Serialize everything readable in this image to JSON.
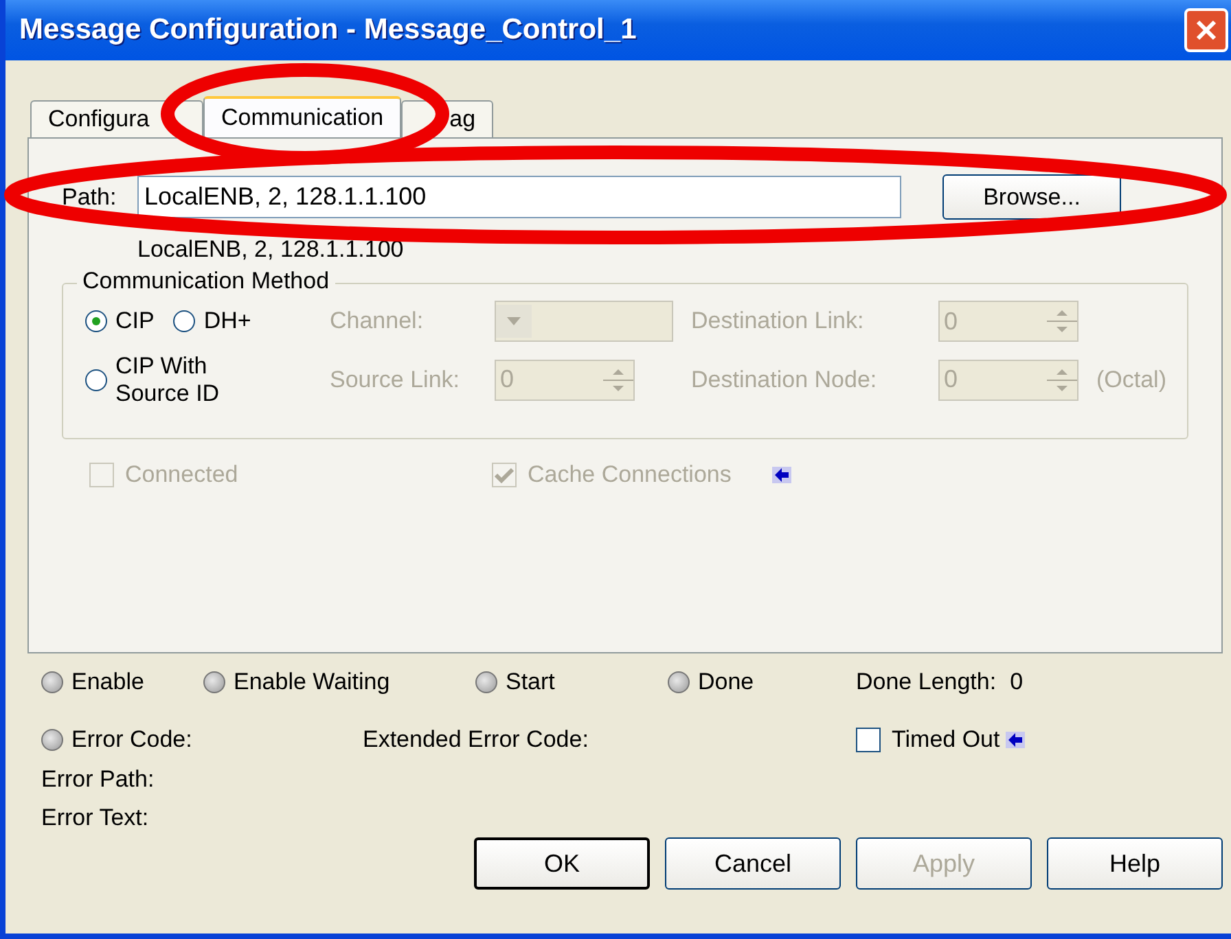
{
  "window": {
    "title": "Message Configuration - Message_Control_1"
  },
  "tabs": [
    {
      "label": "Configura",
      "selected": false
    },
    {
      "label": "Communication",
      "selected": true
    },
    {
      "label": "ag",
      "selected": false
    }
  ],
  "path": {
    "label": "Path:",
    "value": "LocalENB, 2, 128.1.1.100",
    "resolved": "LocalENB, 2, 128.1.1.100"
  },
  "browse_button": {
    "label": "Browse..."
  },
  "communication_method": {
    "title": "Communication Method",
    "radios": [
      {
        "label": "CIP",
        "selected": true
      },
      {
        "label": "DH+",
        "selected": false
      },
      {
        "label": "CIP With Source ID",
        "selected": false
      }
    ],
    "fields": [
      {
        "kind": "dropdown",
        "label": "Channel:",
        "disabled": true
      },
      {
        "kind": "spinner",
        "label": "Destination Link:",
        "value": "0",
        "disabled": true
      },
      {
        "kind": "spinner",
        "label": "Source Link:",
        "value": "0",
        "disabled": true
      },
      {
        "kind": "spinner",
        "label": "Destination Node:",
        "value": "0",
        "disabled": true,
        "suffix": "(Octal)"
      }
    ]
  },
  "options": [
    {
      "label": "Connected",
      "checked": false,
      "disabled": true
    },
    {
      "label": "Cache Connections",
      "checked": true,
      "disabled": true,
      "pointer": true
    }
  ],
  "status": {
    "lamps": [
      {
        "label": "Enable",
        "on": false
      },
      {
        "label": "Enable Waiting",
        "on": false
      },
      {
        "label": "Start",
        "on": false
      },
      {
        "label": "Done",
        "on": false
      }
    ],
    "done_length": {
      "label": "Done Length:",
      "value": "0"
    },
    "error_code": {
      "label": "Error Code:",
      "on": false
    },
    "extended_error_code": "Extended Error Code:",
    "timed_out": {
      "label": "Timed Out",
      "checked": false,
      "pointer": true
    },
    "error_path": "Error Path:",
    "error_text": "Error Text:"
  },
  "buttons": [
    {
      "label": "OK",
      "disabled": false,
      "default": true
    },
    {
      "label": "Cancel",
      "disabled": false,
      "default": false
    },
    {
      "label": "Apply",
      "disabled": true,
      "default": false
    },
    {
      "label": "Help",
      "disabled": false,
      "default": false
    }
  ],
  "annotations": [
    {
      "kind": "ellipse"
    },
    {
      "kind": "ellipse"
    }
  ]
}
